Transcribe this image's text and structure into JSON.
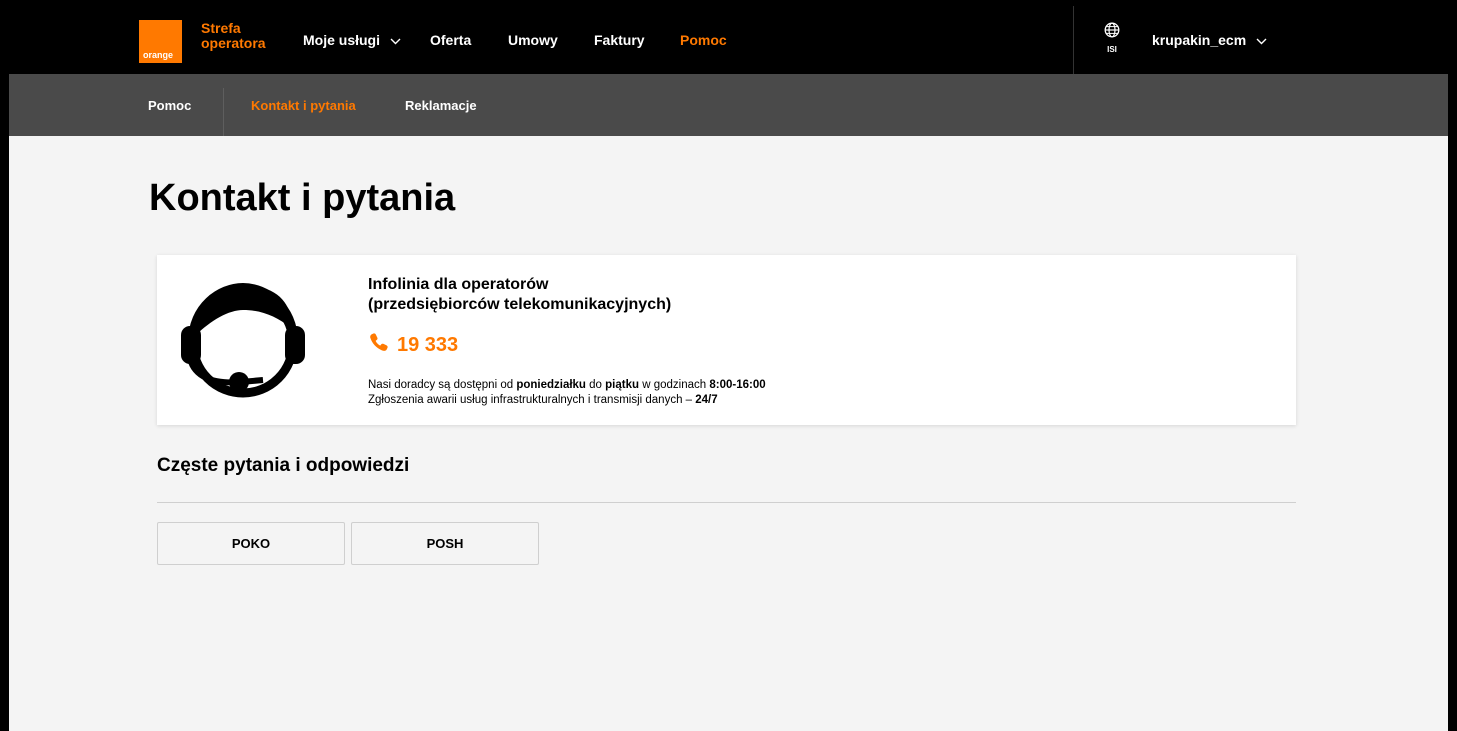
{
  "header": {
    "logo_text": "orange",
    "brand_line1": "Strefa",
    "brand_line2": "operatora",
    "nav": {
      "moje_uslugi": "Moje usługi",
      "oferta": "Oferta",
      "umowy": "Umowy",
      "faktury": "Faktury",
      "pomoc": "Pomoc"
    },
    "language_label": "ISI",
    "username": "krupakin_ecm"
  },
  "subnav": {
    "pomoc": "Pomoc",
    "kontakt": "Kontakt i pytania",
    "reklamacje": "Reklamacje"
  },
  "page": {
    "title": "Kontakt i pytania"
  },
  "contact_card": {
    "title_line1": "Infolinia dla operatorów",
    "title_line2": "(przedsiębiorców telekomunikacyjnych)",
    "phone": "19 333",
    "note1_a": "Nasi doradcy są dostępni od ",
    "note1_b": "poniedziałku",
    "note1_c": " do ",
    "note1_d": "piątku",
    "note1_e": " w godzinach ",
    "note1_f": "8:00-16:00",
    "note2_a": "Zgłoszenia awarii usług infrastrukturalnych i transmisji danych – ",
    "note2_b": "24/7"
  },
  "faq": {
    "title": "Częste pytania i odpowiedzi",
    "buttons": [
      "POKO",
      "POSH"
    ]
  },
  "colors": {
    "accent": "#ff7900",
    "topbar": "#000000",
    "subnav": "#4a4a4a",
    "background": "#f4f4f4"
  },
  "icons": {
    "dropdown": "chevron-down-icon",
    "language": "globe-icon",
    "phone": "phone-icon",
    "support": "headset-agent-icon"
  }
}
